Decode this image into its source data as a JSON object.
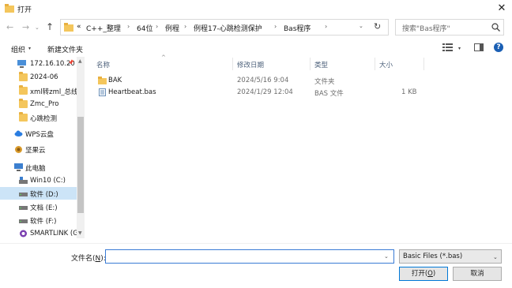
{
  "window": {
    "title": "打开",
    "close_glyph": "✕"
  },
  "nav": {
    "back": "←",
    "forward": "→",
    "recent": "⌄",
    "up": "↑"
  },
  "address": {
    "crumbs": [
      "«",
      "C++_整理",
      "64位",
      "例程",
      "例程17-心跳检测保护",
      "Bas程序"
    ],
    "separator": "›",
    "dropdown": "⌄",
    "refresh": "↻"
  },
  "search": {
    "placeholder": "搜索\"Bas程序\""
  },
  "toolbar": {
    "organize": "组织",
    "organize_caret": "▾",
    "new_folder": "新建文件夹",
    "view_caret": "▾",
    "help": "?"
  },
  "sidebar": {
    "items": [
      {
        "label": "172.16.10.20",
        "icon": "network-computer-icon",
        "pin": "📌"
      },
      {
        "label": "2024-06",
        "icon": "folder-icon"
      },
      {
        "label": "xml转zml_总线B",
        "icon": "folder-icon"
      },
      {
        "label": "Zmc_Pro",
        "icon": "folder-icon"
      },
      {
        "label": "心跳检测",
        "icon": "folder-icon"
      },
      {
        "label": "WPS云盘",
        "icon": "cloud-icon"
      },
      {
        "label": "坚果云",
        "icon": "nut-icon"
      },
      {
        "label": "此电脑",
        "icon": "computer-icon"
      },
      {
        "label": "Win10 (C:)",
        "icon": "system-drive-icon"
      },
      {
        "label": "软件 (D:)",
        "icon": "drive-icon",
        "selected": true
      },
      {
        "label": "文档 (E:)",
        "icon": "drive-icon"
      },
      {
        "label": "软件 (F:)",
        "icon": "drive-icon"
      },
      {
        "label": "SMARTLINK (G",
        "icon": "usb-drive-icon"
      }
    ],
    "scroll_up": "▲",
    "scroll_down": "▼"
  },
  "files": {
    "sort_arrow": "^",
    "columns": {
      "name": "名称",
      "date": "修改日期",
      "type": "类型",
      "size": "大小"
    },
    "rows": [
      {
        "name": "BAK",
        "date": "2024/5/16 9:04",
        "type": "文件夹",
        "size": "",
        "icon": "folder-icon"
      },
      {
        "name": "Heartbeat.bas",
        "date": "2024/1/29 12:04",
        "type": "BAS 文件",
        "size": "1 KB",
        "icon": "document-icon"
      }
    ]
  },
  "bottom": {
    "filename_label": "文件名",
    "filename_label_key": "N",
    "filename_value": "",
    "filename_caret": "⌄",
    "filetype": "Basic Files (*.bas)",
    "filetype_caret": "⌄",
    "open_label": "打开",
    "open_key": "O",
    "cancel_label": "取消"
  },
  "colors": {
    "accent": "#0078d7",
    "selection": "#cce4f7",
    "folder": "#f4c65c",
    "header_text": "#4c607a"
  }
}
